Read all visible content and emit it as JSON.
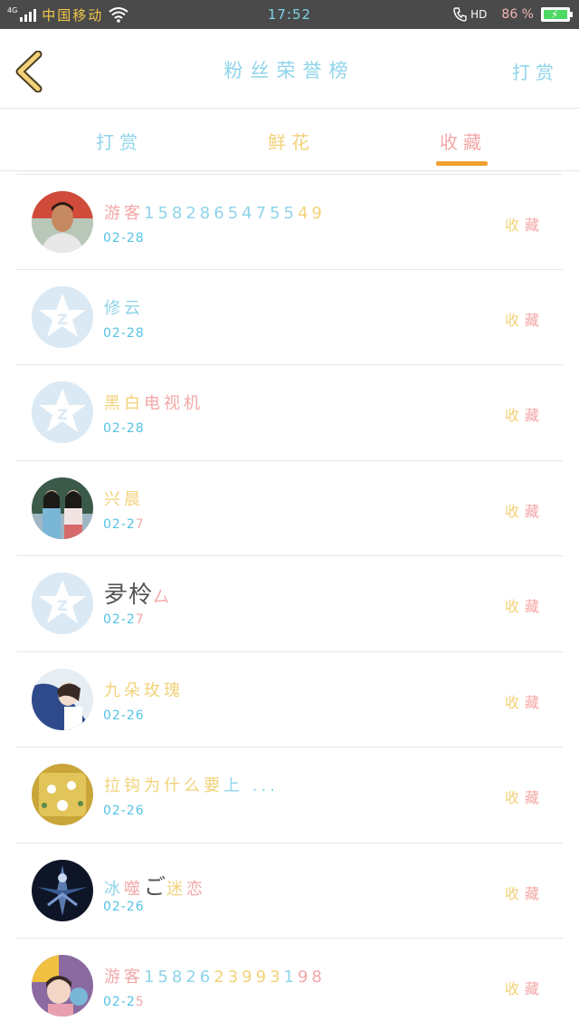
{
  "status_bar": {
    "network": "4G",
    "carrier": "中国移动",
    "time": "17:52",
    "call_hd": "HD",
    "battery": "86 %"
  },
  "header": {
    "title": "粉丝荣誉榜",
    "action": "打赏"
  },
  "tabs": [
    {
      "label": "打赏",
      "active": false
    },
    {
      "label": "鲜花",
      "active": false
    },
    {
      "label": "收藏",
      "active": true
    }
  ],
  "list": [
    {
      "name": "游客15828654755 49",
      "date": "02-28",
      "action": "收藏",
      "avatar": "photo-man"
    },
    {
      "name": "修云",
      "date": "02-28",
      "action": "收藏",
      "avatar": "default-qq"
    },
    {
      "name": "黑白电视机",
      "date": "02-28",
      "action": "收藏",
      "avatar": "default-qq"
    },
    {
      "name": "兴晨",
      "date": "02-27",
      "action": "收藏",
      "avatar": "photo-girls"
    },
    {
      "name": "夛柃厶",
      "date": "02-27",
      "action": "收藏",
      "avatar": "default-qq"
    },
    {
      "name": "九朵玫瑰",
      "date": "02-26",
      "action": "收藏",
      "avatar": "photo-sky"
    },
    {
      "name": "拉钩为什么要上 ...",
      "date": "02-26",
      "action": "收藏",
      "avatar": "photo-game"
    },
    {
      "name": "冰噬ご迷恋",
      "date": "02-26",
      "action": "收藏",
      "avatar": "photo-dark"
    },
    {
      "name": "游客15826239931 98",
      "date": "02-25",
      "action": "收藏",
      "avatar": "photo-kid"
    }
  ],
  "colors": {
    "accent_blue": "#8fd4ea",
    "accent_yellow": "#f2d27a",
    "accent_pink": "#f4a7a7",
    "tab_indicator": "#f0a030",
    "date_blue": "#55c3e6"
  }
}
